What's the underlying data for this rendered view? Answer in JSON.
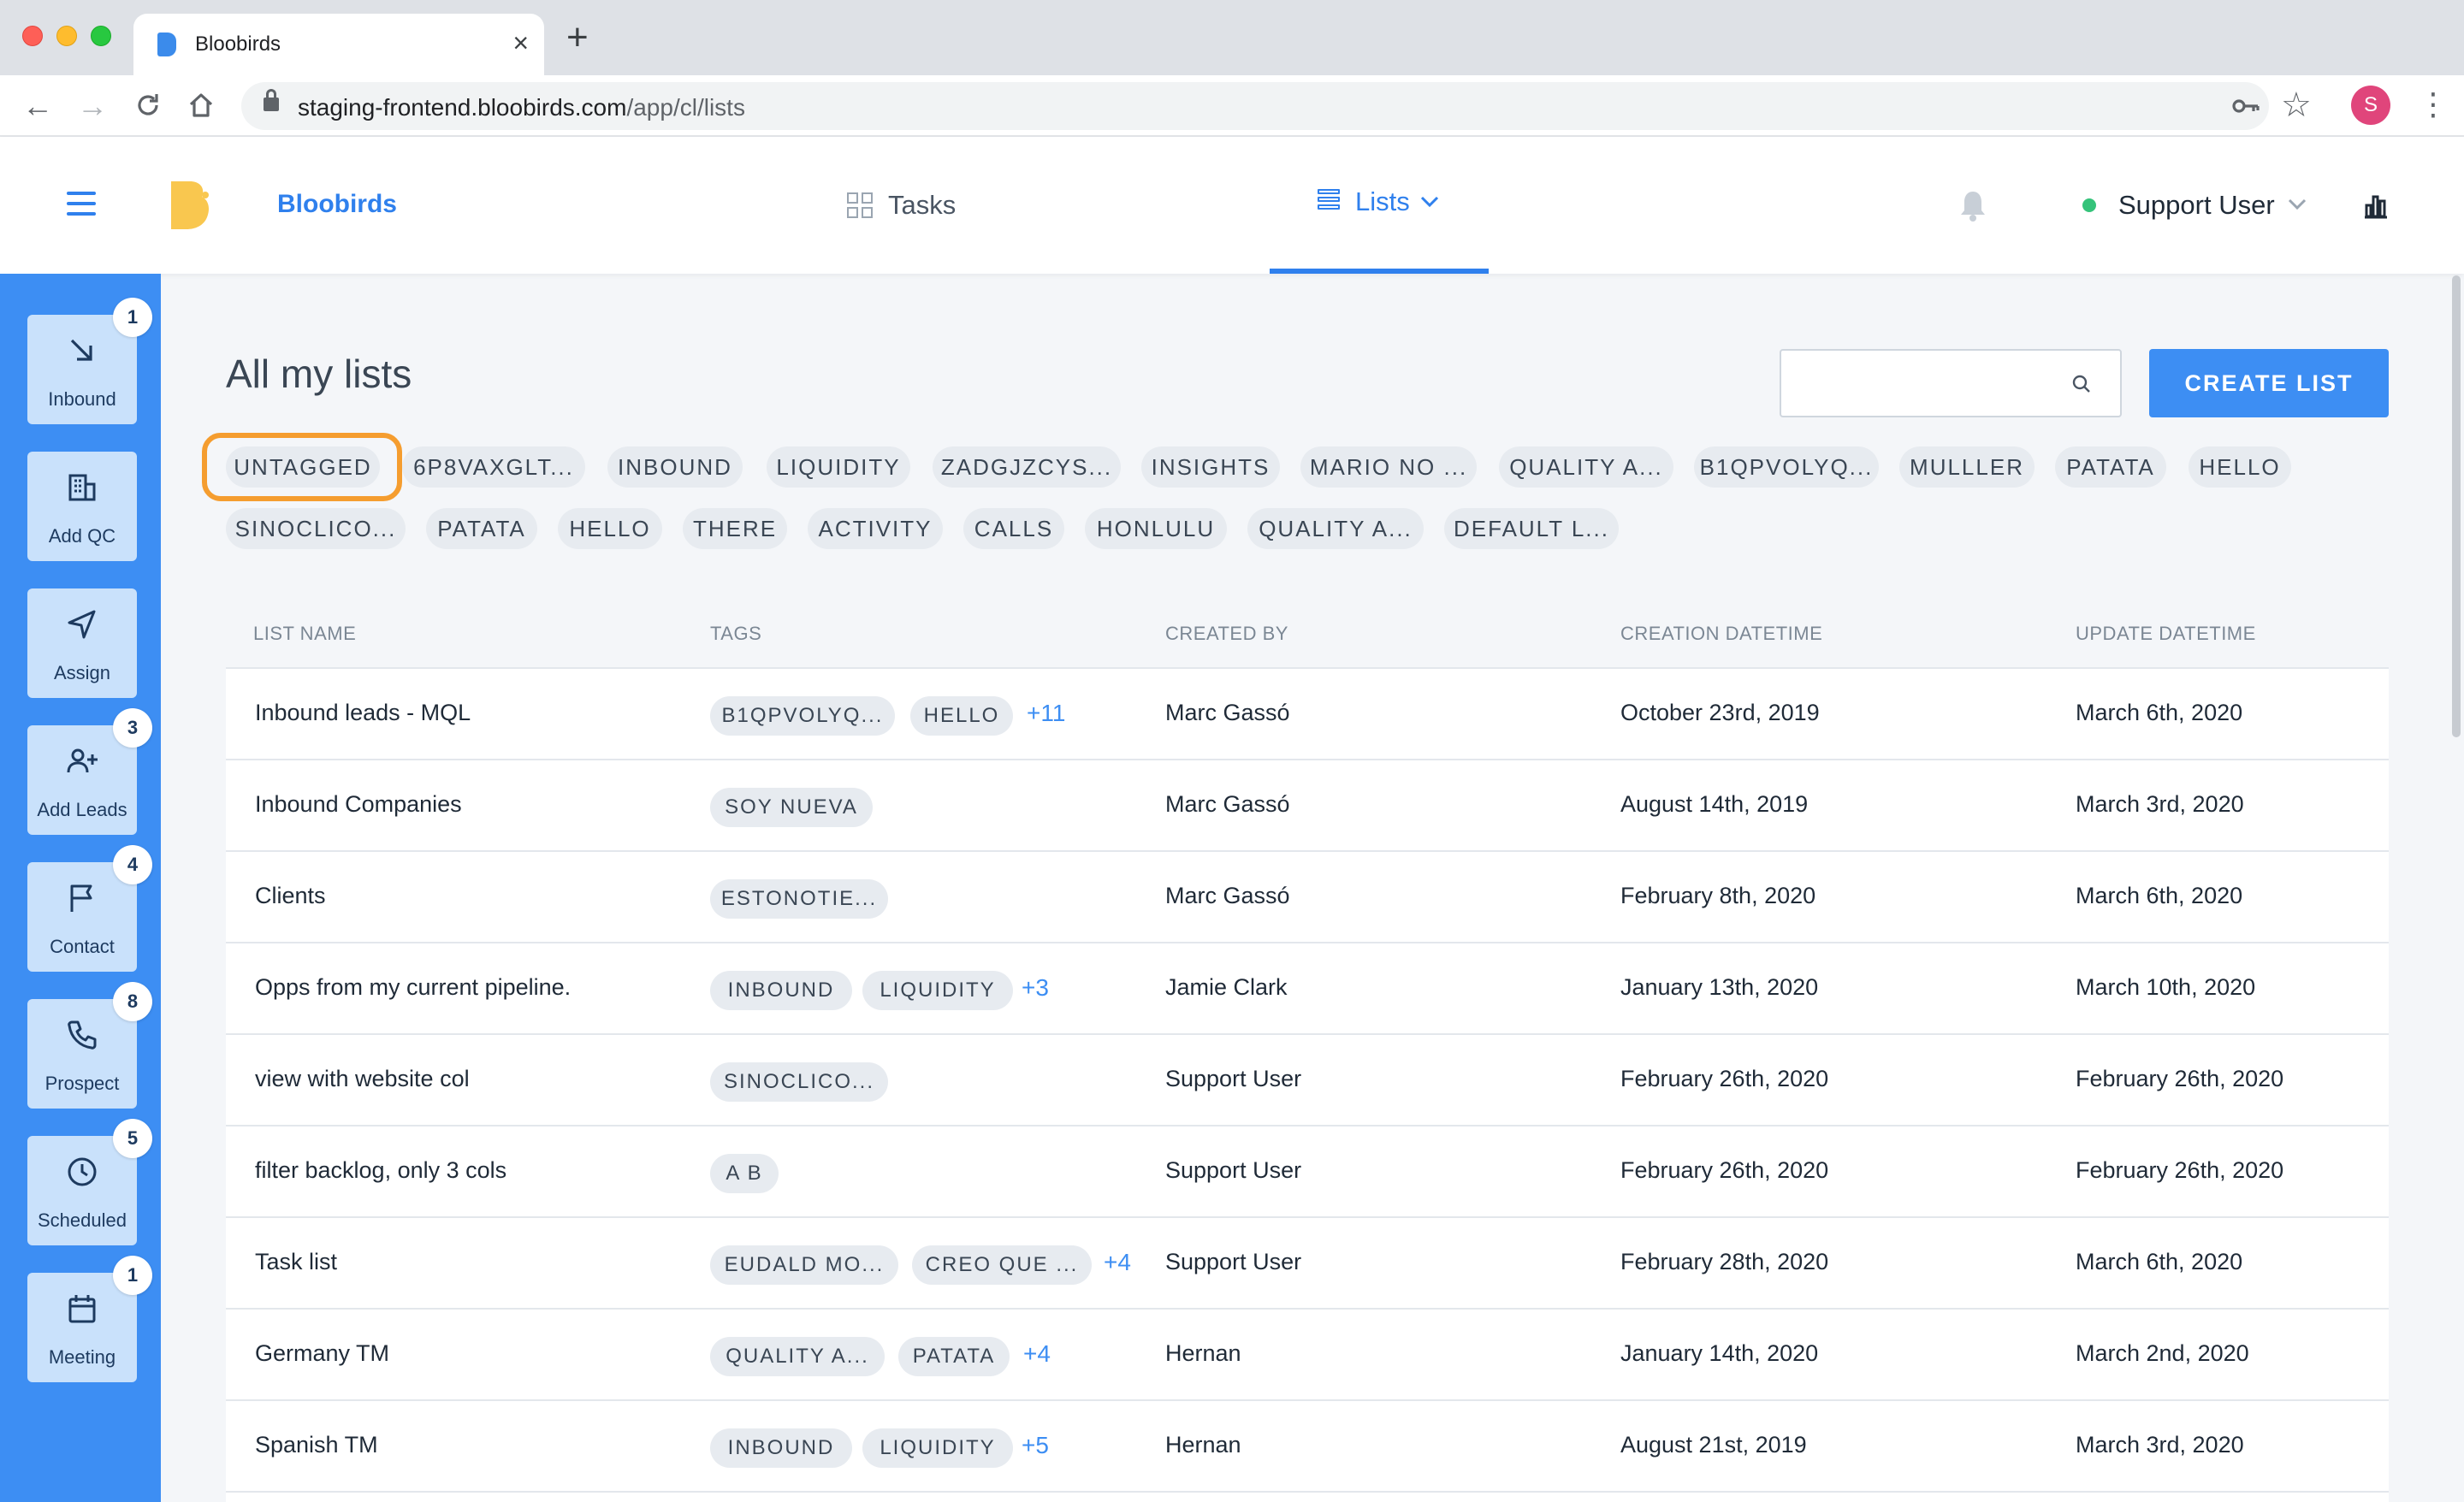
{
  "browser": {
    "tab_title": "Bloobirds",
    "url_host": "staging-frontend.bloobirds.com",
    "url_path": "/app/cl/lists",
    "profile_initial": "S"
  },
  "header": {
    "brand": "Bloobirds",
    "tasks_label": "Tasks",
    "lists_label": "Lists",
    "user_name": "Support User"
  },
  "sidebar": {
    "items": [
      {
        "label": "Inbound",
        "badge": "1",
        "icon": "arrow-down-right-icon"
      },
      {
        "label": "Add QC",
        "badge": "",
        "icon": "building-icon"
      },
      {
        "label": "Assign",
        "badge": "",
        "icon": "navigation-icon"
      },
      {
        "label": "Add Leads",
        "badge": "3",
        "icon": "user-plus-icon"
      },
      {
        "label": "Contact",
        "badge": "4",
        "icon": "flag-icon"
      },
      {
        "label": "Prospect",
        "badge": "8",
        "icon": "phone-icon"
      },
      {
        "label": "Scheduled",
        "badge": "5",
        "icon": "clock-icon"
      },
      {
        "label": "Meeting",
        "badge": "1",
        "icon": "calendar-icon"
      }
    ]
  },
  "main": {
    "title": "All my lists",
    "search_placeholder": "",
    "create_button": "CREATE LIST",
    "filter_chips": [
      "UNTAGGED",
      "6P8VAXGLT...",
      "INBOUND",
      "LIQUIDITY",
      "ZADGJZCYS...",
      "INSIGHTS",
      "MARIO NO ...",
      "QUALITY A...",
      "B1QPVOLYQ...",
      "MULLLER",
      "PATATA",
      "HELLO",
      "SINOCLICO...",
      "PATATA",
      "HELLO",
      "THERE",
      "ACTIVITY",
      "CALLS",
      "HONLULU",
      "QUALITY A...",
      "DEFAULT L..."
    ],
    "selected_chip": "UNTAGGED"
  },
  "table": {
    "columns": [
      "LIST NAME",
      "TAGS",
      "CREATED BY",
      "CREATION DATETIME",
      "UPDATE DATETIME"
    ],
    "rows": [
      {
        "name": "Inbound leads - MQL",
        "tags": [
          "B1QPVOLYQ...",
          "HELLO"
        ],
        "more": "+11",
        "created_by": "Marc Gassó",
        "created": "October 23rd, 2019",
        "updated": "March 6th, 2020"
      },
      {
        "name": "Inbound Companies",
        "tags": [
          "SOY NUEVA"
        ],
        "more": "",
        "created_by": "Marc Gassó",
        "created": "August 14th, 2019",
        "updated": "March 3rd, 2020"
      },
      {
        "name": "Clients",
        "tags": [
          "ESTONOTIE..."
        ],
        "more": "",
        "created_by": "Marc Gassó",
        "created": "February 8th, 2020",
        "updated": "March 6th, 2020"
      },
      {
        "name": "Opps from my current pipeline.",
        "tags": [
          "INBOUND",
          "LIQUIDITY"
        ],
        "more": "+3",
        "created_by": "Jamie Clark",
        "created": "January 13th, 2020",
        "updated": "March 10th, 2020"
      },
      {
        "name": "view with website col",
        "tags": [
          "SINOCLICO..."
        ],
        "more": "",
        "created_by": "Support User",
        "created": "February 26th, 2020",
        "updated": "February 26th, 2020"
      },
      {
        "name": "filter backlog, only 3 cols",
        "tags": [
          "A B"
        ],
        "more": "",
        "created_by": "Support User",
        "created": "February 26th, 2020",
        "updated": "February 26th, 2020"
      },
      {
        "name": "Task list",
        "tags": [
          "EUDALD MO...",
          "CREO QUE ..."
        ],
        "more": "+4",
        "created_by": "Support User",
        "created": "February 28th, 2020",
        "updated": "March 6th, 2020"
      },
      {
        "name": "Germany TM",
        "tags": [
          "QUALITY A...",
          "PATATA"
        ],
        "more": "+4",
        "created_by": "Hernan",
        "created": "January 14th, 2020",
        "updated": "March 2nd, 2020"
      },
      {
        "name": "Spanish TM",
        "tags": [
          "INBOUND",
          "LIQUIDITY"
        ],
        "more": "+5",
        "created_by": "Hernan",
        "created": "August 21st, 2019",
        "updated": "March 3rd, 2020"
      }
    ]
  },
  "colors": {
    "accent": "#3d8ef3",
    "sidebar_item_bg": "#c9e1fb",
    "chip_bg": "#e7ebf0",
    "highlight_ring": "#f59d2f",
    "online": "#35c37a"
  }
}
